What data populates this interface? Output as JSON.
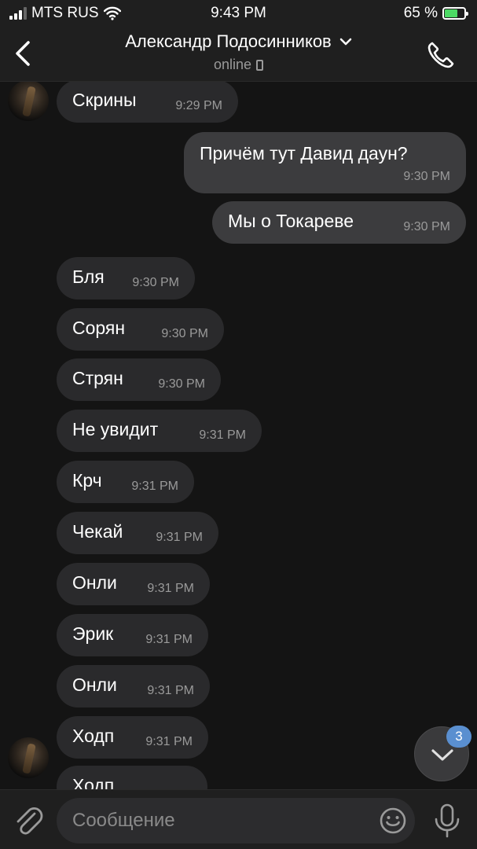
{
  "status_bar": {
    "carrier": "MTS RUS",
    "time": "9:43 PM",
    "battery_percent": "65 %",
    "battery_level": 0.65,
    "icons": [
      "signal-icon",
      "wifi-icon",
      "battery-charging-icon"
    ]
  },
  "header": {
    "title": "Александр Подосинников",
    "status": "online",
    "icons": [
      "back-chevron-icon",
      "chevron-down-icon",
      "mobile-device-icon",
      "phone-call-icon"
    ]
  },
  "messages": [
    {
      "direction": "in",
      "text": "Скрины",
      "time": "9:29 PM"
    },
    {
      "direction": "out",
      "text": "Причём тут Давид даун?",
      "time": "9:30 PM"
    },
    {
      "direction": "out",
      "text": "Мы о Токареве",
      "time": "9:30 PM"
    },
    {
      "direction": "in",
      "text": "Бля",
      "time": "9:30 PM"
    },
    {
      "direction": "in",
      "text": "Сорян",
      "time": "9:30 PM"
    },
    {
      "direction": "in",
      "text": "Стрян",
      "time": "9:30 PM"
    },
    {
      "direction": "in",
      "text": "Не увидит",
      "time": "9:31 PM"
    },
    {
      "direction": "in",
      "text": "Крч",
      "time": "9:31 PM"
    },
    {
      "direction": "in",
      "text": "Чекай",
      "time": "9:31 PM"
    },
    {
      "direction": "in",
      "text": "Онли",
      "time": "9:31 PM"
    },
    {
      "direction": "in",
      "text": "Эрик",
      "time": "9:31 PM"
    },
    {
      "direction": "in",
      "text": "Онли",
      "time": "9:31 PM"
    },
    {
      "direction": "in",
      "text": "Ходп",
      "time": "9:31 PM"
    },
    {
      "direction": "in",
      "text": "Ходп",
      "time": ""
    }
  ],
  "scroll_down": {
    "unread_count": "3",
    "icon": "chevron-down-icon"
  },
  "composer": {
    "placeholder": "Сообщение",
    "value": "",
    "icons": [
      "paperclip-icon",
      "emoji-icon",
      "microphone-icon"
    ]
  },
  "colors": {
    "background": "#141414",
    "bar": "#1f1f1f",
    "incoming_bubble": "#2a2a2c",
    "outgoing_bubble": "#3c3c3e",
    "badge": "#5a8fd0",
    "battery_fill": "#4cd964"
  }
}
